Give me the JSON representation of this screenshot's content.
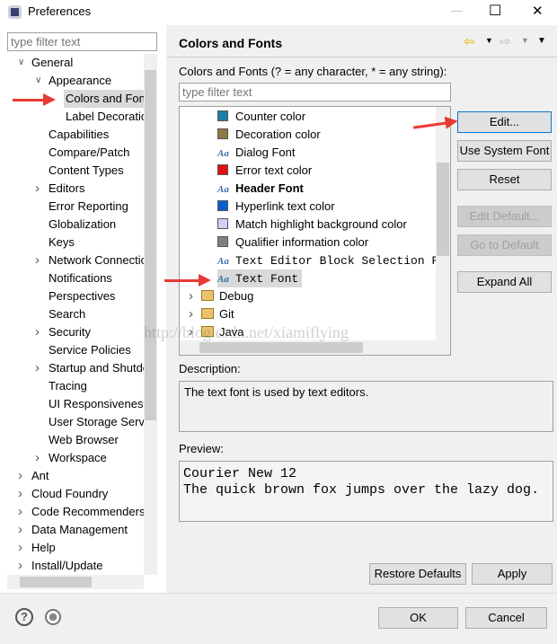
{
  "window": {
    "title": "Preferences",
    "minimize": "—",
    "maximize": "☐",
    "close": "✕"
  },
  "left": {
    "filter_placeholder": "type filter text",
    "tree": [
      {
        "label": "General",
        "level": 0,
        "chevron": "down"
      },
      {
        "label": "Appearance",
        "level": 1,
        "chevron": "down"
      },
      {
        "label": "Colors and Fonts",
        "level": 2,
        "selected": true
      },
      {
        "label": "Label Decorations",
        "level": 2
      },
      {
        "label": "Capabilities",
        "level": 1
      },
      {
        "label": "Compare/Patch",
        "level": 1
      },
      {
        "label": "Content Types",
        "level": 1
      },
      {
        "label": "Editors",
        "level": 1,
        "chevron": "right"
      },
      {
        "label": "Error Reporting",
        "level": 1
      },
      {
        "label": "Globalization",
        "level": 1
      },
      {
        "label": "Keys",
        "level": 1
      },
      {
        "label": "Network Connections",
        "level": 1,
        "chevron": "right"
      },
      {
        "label": "Notifications",
        "level": 1
      },
      {
        "label": "Perspectives",
        "level": 1
      },
      {
        "label": "Search",
        "level": 1
      },
      {
        "label": "Security",
        "level": 1,
        "chevron": "right"
      },
      {
        "label": "Service Policies",
        "level": 1
      },
      {
        "label": "Startup and Shutdown",
        "level": 1,
        "chevron": "right"
      },
      {
        "label": "Tracing",
        "level": 1
      },
      {
        "label": "UI Responsiveness",
        "level": 1
      },
      {
        "label": "User Storage Service",
        "level": 1
      },
      {
        "label": "Web Browser",
        "level": 1
      },
      {
        "label": "Workspace",
        "level": 1,
        "chevron": "right"
      },
      {
        "label": "Ant",
        "level": 0,
        "chevron": "right"
      },
      {
        "label": "Cloud Foundry",
        "level": 0,
        "chevron": "right"
      },
      {
        "label": "Code Recommenders",
        "level": 0,
        "chevron": "right"
      },
      {
        "label": "Data Management",
        "level": 0,
        "chevron": "right"
      },
      {
        "label": "Help",
        "level": 0,
        "chevron": "right"
      },
      {
        "label": "Install/Update",
        "level": 0,
        "chevron": "right"
      }
    ]
  },
  "main": {
    "title": "Colors and Fonts",
    "filter_label": "Colors and Fonts (? = any character, * = any string):",
    "filter_placeholder": "type filter text",
    "items": [
      {
        "label": "Counter color",
        "type": "color",
        "color": "#1a7fa8"
      },
      {
        "label": "Decoration color",
        "type": "color",
        "color": "#8c7a45"
      },
      {
        "label": "Dialog Font",
        "type": "font"
      },
      {
        "label": "Error text color",
        "type": "color",
        "color": "#e01010"
      },
      {
        "label": "Header Font",
        "type": "font",
        "bold": true
      },
      {
        "label": "Hyperlink text color",
        "type": "color",
        "color": "#0a5fd0"
      },
      {
        "label": "Match highlight background color",
        "type": "color",
        "color": "#d0d0f5"
      },
      {
        "label": "Qualifier information color",
        "type": "color",
        "color": "#808080"
      },
      {
        "label": "Text Editor Block Selection Font",
        "type": "font",
        "mono": true
      },
      {
        "label": "Text Font",
        "type": "font",
        "mono": true,
        "selected": true
      },
      {
        "label": "Debug",
        "type": "folder"
      },
      {
        "label": "Git",
        "type": "folder"
      },
      {
        "label": "Java",
        "type": "folder"
      }
    ],
    "watermark": "http://blog.csdn.net/xiamiflying",
    "buttons": {
      "edit": "Edit...",
      "use_system_font": "Use System Font",
      "reset": "Reset",
      "edit_default": "Edit Default...",
      "go_to_default": "Go to Default",
      "expand_all": "Expand All"
    },
    "description_label": "Description:",
    "description": "The text font is used by text editors.",
    "preview_label": "Preview:",
    "preview_line1": "Courier New 12",
    "preview_line2": "The quick brown fox jumps over the lazy dog.",
    "restore_defaults": "Restore Defaults",
    "apply": "Apply"
  },
  "footer": {
    "ok": "OK",
    "cancel": "Cancel",
    "help_icon": "?"
  }
}
